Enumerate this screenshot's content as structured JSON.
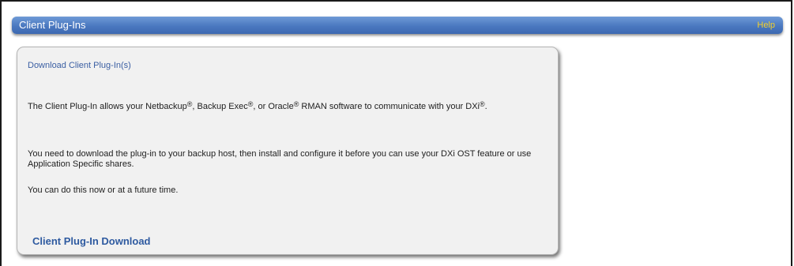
{
  "header": {
    "title": "Client Plug-Ins",
    "help_label": "Help"
  },
  "panel": {
    "title": "Download Client Plug-In(s)",
    "paragraph1": {
      "a": "The Client Plug-In allows your Netbackup",
      "b": ", Backup Exec",
      "c": ", or Oracle",
      "d": " RMAN software to communicate with your DXi",
      "e": ".",
      "reg_mark": "®"
    },
    "paragraph2": "You need to download the plug-in to your backup host, then install and configure it before you can use your DXi OST feature or use Application Specific shares.",
    "paragraph3": "You can do this now or at a future time.",
    "download_link": "Client Plug-In Download"
  },
  "colors": {
    "header_blue": "#4a78c0",
    "help_yellow": "#f5d12a",
    "panel_bg": "#f1f1f1",
    "link_blue": "#2e5aa0"
  }
}
